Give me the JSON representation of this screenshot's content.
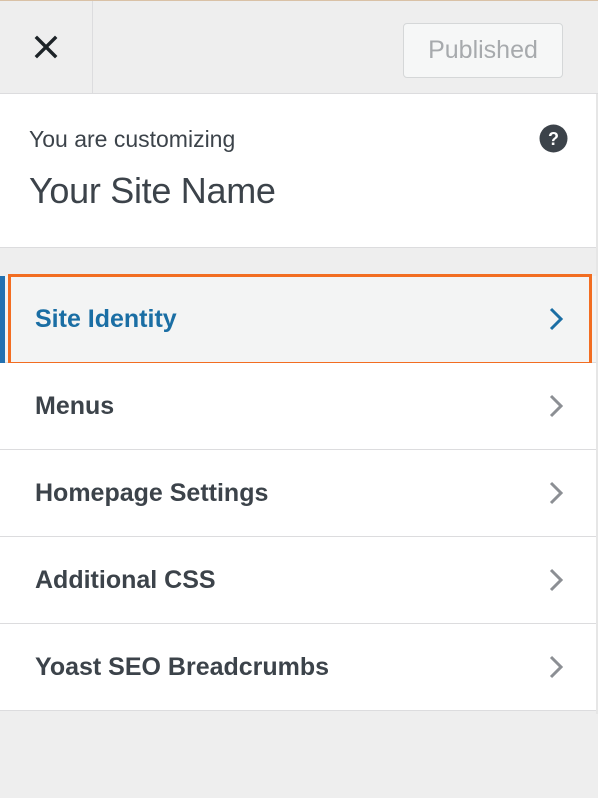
{
  "header": {
    "close_label": "Close",
    "publish_label": "Published"
  },
  "info": {
    "preamble": "You are customizing",
    "site_name": "Your Site Name",
    "help_icon": "help-icon"
  },
  "sections": [
    {
      "label": "Site Identity",
      "active": true
    },
    {
      "label": "Menus",
      "active": false
    },
    {
      "label": "Homepage Settings",
      "active": false
    },
    {
      "label": "Additional CSS",
      "active": false
    },
    {
      "label": "Yoast SEO Breadcrumbs",
      "active": false
    }
  ],
  "colors": {
    "accent": "#2271b1",
    "active_text": "#1a6ea4",
    "highlight_border": "#f26d21",
    "text": "#3c434a"
  }
}
